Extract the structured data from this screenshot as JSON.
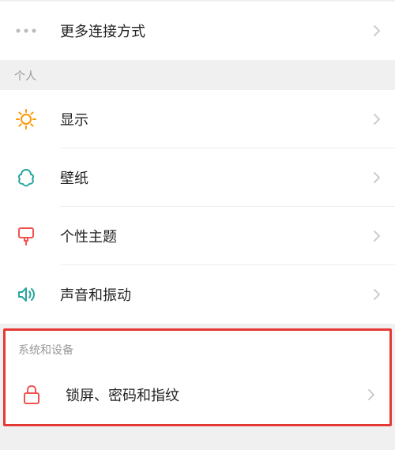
{
  "top": {
    "more_connections": "更多连接方式"
  },
  "sections": {
    "personal": {
      "header": "个人",
      "display": "显示",
      "wallpaper": "壁纸",
      "theme": "个性主题",
      "sound": "声音和振动"
    },
    "system": {
      "header": "系统和设备",
      "lockscreen": "锁屏、密码和指纹"
    }
  },
  "colors": {
    "accent_orange": "#ff9800",
    "accent_teal": "#26a69a",
    "accent_red": "#ef5350",
    "accent_highlight": "#e53935",
    "icon_gray": "#bbb"
  }
}
